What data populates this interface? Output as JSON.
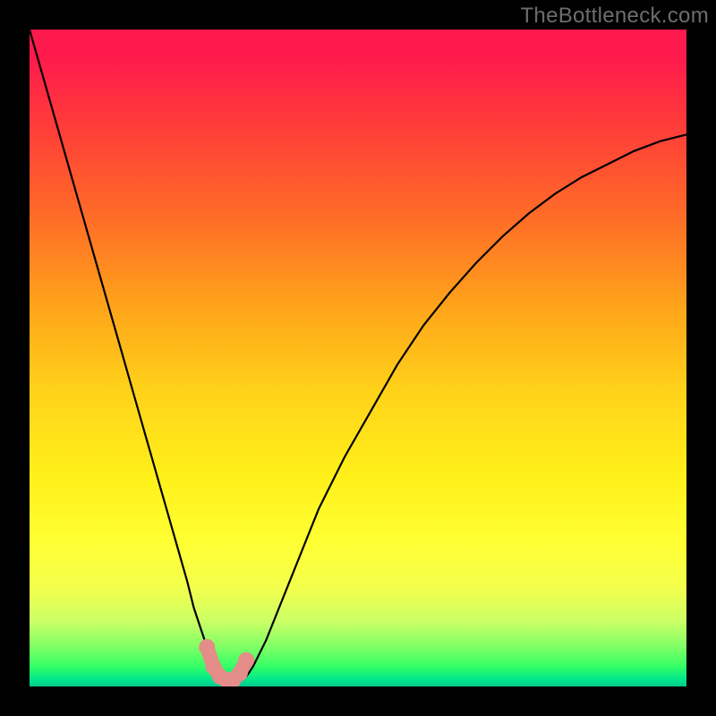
{
  "watermark": "TheBottleneck.com",
  "colors": {
    "gradient_top": "#ff1a4d",
    "gradient_bottom": "#00c98c",
    "curve": "#000000",
    "marker": "#e48d89",
    "frame": "#000000"
  },
  "chart_data": {
    "type": "line",
    "title": "",
    "xlabel": "",
    "ylabel": "",
    "xlim": [
      0,
      100
    ],
    "ylim": [
      0,
      100
    ],
    "grid": false,
    "x": [
      0,
      2,
      4,
      6,
      8,
      10,
      12,
      14,
      16,
      18,
      20,
      22,
      24,
      25,
      26,
      27,
      28,
      29,
      30,
      31,
      32,
      33,
      34,
      36,
      38,
      40,
      42,
      44,
      46,
      48,
      52,
      56,
      60,
      64,
      68,
      72,
      76,
      80,
      84,
      88,
      92,
      96,
      100
    ],
    "values": [
      100,
      93,
      86,
      79,
      72,
      65,
      58,
      51,
      44,
      37,
      30,
      23,
      16,
      12,
      9,
      6,
      4,
      2.5,
      1.5,
      1,
      1,
      1.5,
      3,
      7,
      12,
      17,
      22,
      27,
      31,
      35,
      42,
      49,
      55,
      60,
      64.5,
      68.5,
      72,
      75,
      77.5,
      79.5,
      81.5,
      83,
      84
    ],
    "markers": {
      "x": [
        27,
        28,
        29,
        30,
        31,
        32,
        33
      ],
      "values": [
        6,
        3,
        1.5,
        1,
        1,
        2,
        4
      ]
    },
    "annotations": []
  }
}
